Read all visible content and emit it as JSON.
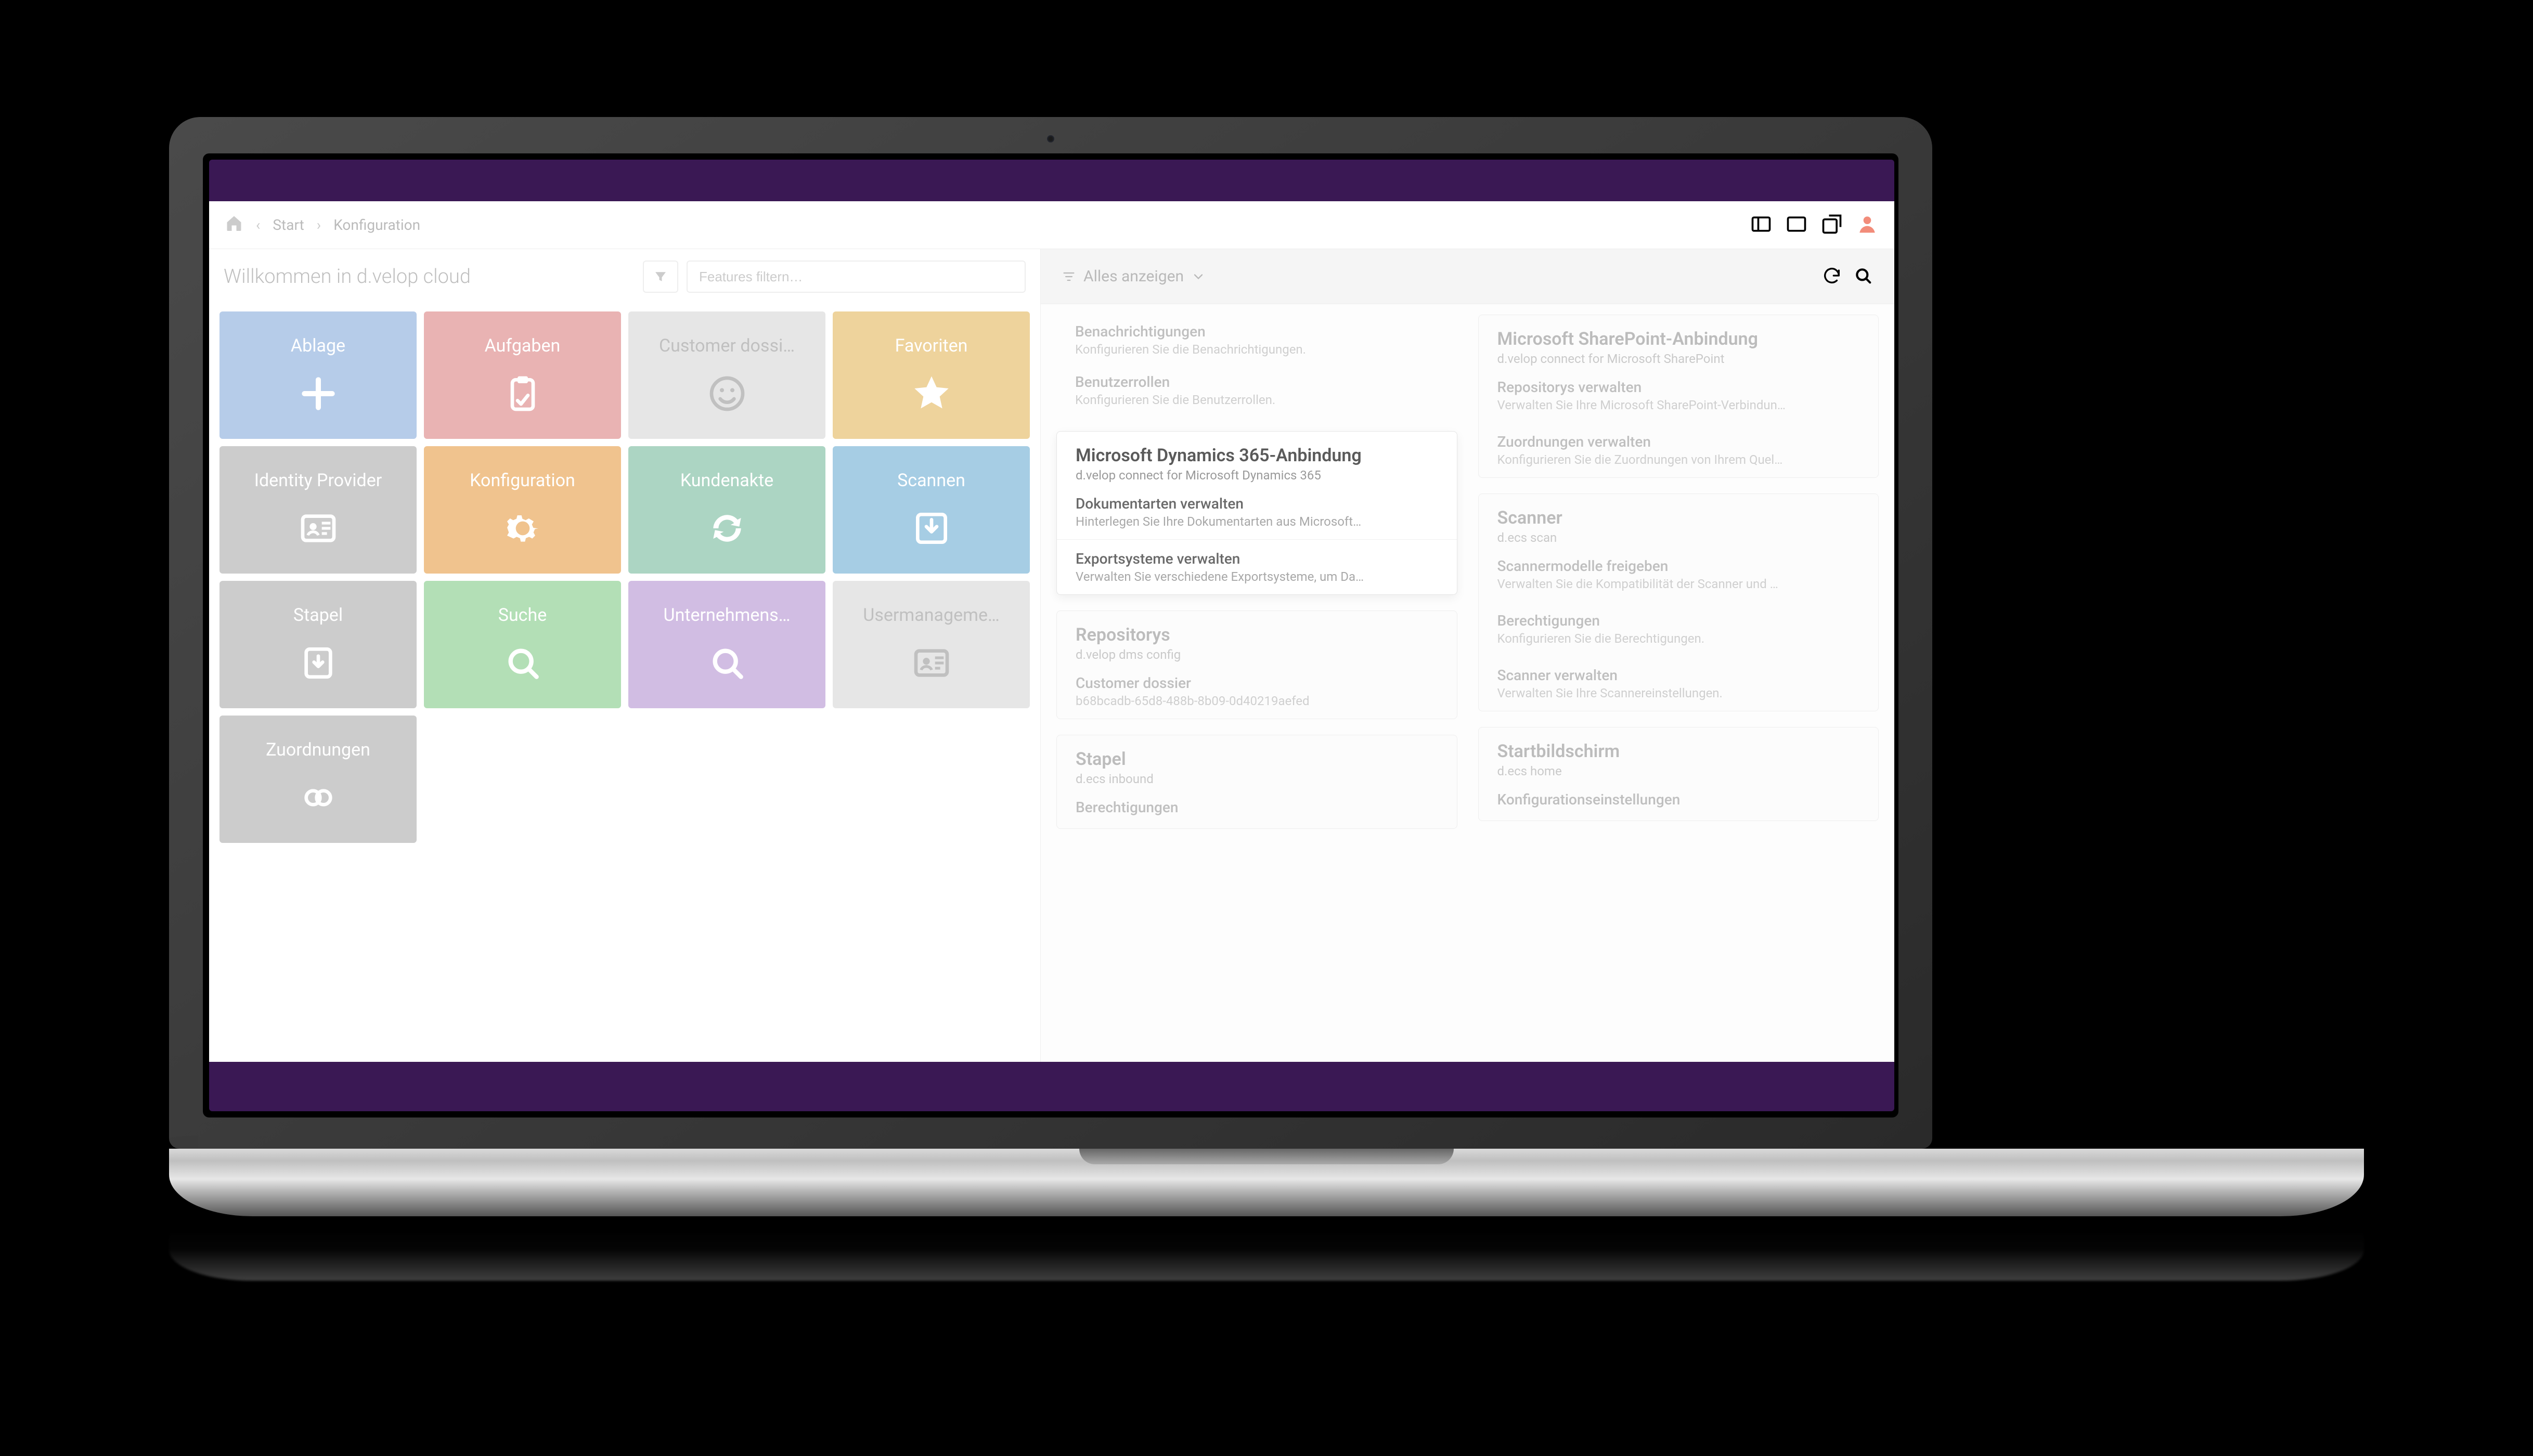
{
  "breadcrumb": {
    "item1": "Start",
    "item2": "Konfiguration"
  },
  "welcome": "Willkommen in d.velop cloud",
  "feature_filter": {
    "placeholder": "Features filtern…"
  },
  "panel": {
    "dropdown_label": "Alles anzeigen"
  },
  "tiles": [
    {
      "label": "Ablage",
      "icon": "plus",
      "color": "c-blue"
    },
    {
      "label": "Aufgaben",
      "icon": "clipboard",
      "color": "c-red"
    },
    {
      "label": "Customer dossi…",
      "icon": "smile",
      "color": "c-greylt"
    },
    {
      "label": "Favoriten",
      "icon": "star",
      "color": "c-yellow"
    },
    {
      "label": "Identity Provider",
      "icon": "idcard",
      "color": "c-greymd"
    },
    {
      "label": "Konfiguration",
      "icon": "gear",
      "color": "c-orange"
    },
    {
      "label": "Kundenakte",
      "icon": "cycle",
      "color": "c-teal"
    },
    {
      "label": "Scannen",
      "icon": "download",
      "color": "c-cyan"
    },
    {
      "label": "Stapel",
      "icon": "stack",
      "color": "c-greymd"
    },
    {
      "label": "Suche",
      "icon": "search",
      "color": "c-green"
    },
    {
      "label": "Unternehmens…",
      "icon": "search",
      "color": "c-purple"
    },
    {
      "label": "Usermanageme…",
      "icon": "idcard",
      "color": "c-greylt"
    },
    {
      "label": "Zuordnungen",
      "icon": "link",
      "color": "c-greymd"
    }
  ],
  "top_plain_items": [
    {
      "title": "Benachrichtigungen",
      "desc": "Konfigurieren Sie die Benachrichtigungen."
    },
    {
      "title": "Benutzerrollen",
      "desc": "Konfigurieren Sie die Benutzerrollen."
    }
  ],
  "cards_left": [
    {
      "title": "Microsoft Dynamics 365-Anbindung",
      "sub": "d.velop connect for Microsoft Dynamics 365",
      "highlight": true,
      "items": [
        {
          "title": "Dokumentarten verwalten",
          "desc": "Hinterlegen Sie Ihre Dokumentarten aus Microsoft…"
        },
        {
          "title": "Exportsysteme verwalten",
          "desc": "Verwalten Sie verschiedene Exportsysteme, um Da…"
        }
      ]
    },
    {
      "title": "Repositorys",
      "sub": "d.velop dms config",
      "highlight": false,
      "items": [
        {
          "title": "Customer dossier",
          "desc": "b68bcadb-65d8-488b-8b09-0d40219aefed"
        }
      ]
    },
    {
      "title": "Stapel",
      "sub": "d.ecs inbound",
      "highlight": false,
      "items": [
        {
          "title": "Berechtigungen",
          "desc": ""
        }
      ]
    }
  ],
  "cards_right": [
    {
      "title": "Microsoft SharePoint-Anbindung",
      "sub": "d.velop connect for Microsoft SharePoint",
      "highlight": false,
      "items": [
        {
          "title": "Repositorys verwalten",
          "desc": "Verwalten Sie Ihre Microsoft SharePoint-Verbindun…"
        },
        {
          "title": "Zuordnungen verwalten",
          "desc": "Konfigurieren Sie die Zuordnungen von Ihrem Quel…"
        }
      ]
    },
    {
      "title": "Scanner",
      "sub": "d.ecs scan",
      "highlight": false,
      "items": [
        {
          "title": "Scannermodelle freigeben",
          "desc": "Verwalten Sie die Kompatibilität der Scanner und …"
        },
        {
          "title": "Berechtigungen",
          "desc": "Konfigurieren Sie die Berechtigungen."
        },
        {
          "title": "Scanner verwalten",
          "desc": "Verwalten Sie Ihre Scannereinstellungen."
        }
      ]
    },
    {
      "title": "Startbildschirm",
      "sub": "d.ecs home",
      "highlight": false,
      "items": [
        {
          "title": "Konfigurationseinstellungen",
          "desc": ""
        }
      ]
    }
  ]
}
